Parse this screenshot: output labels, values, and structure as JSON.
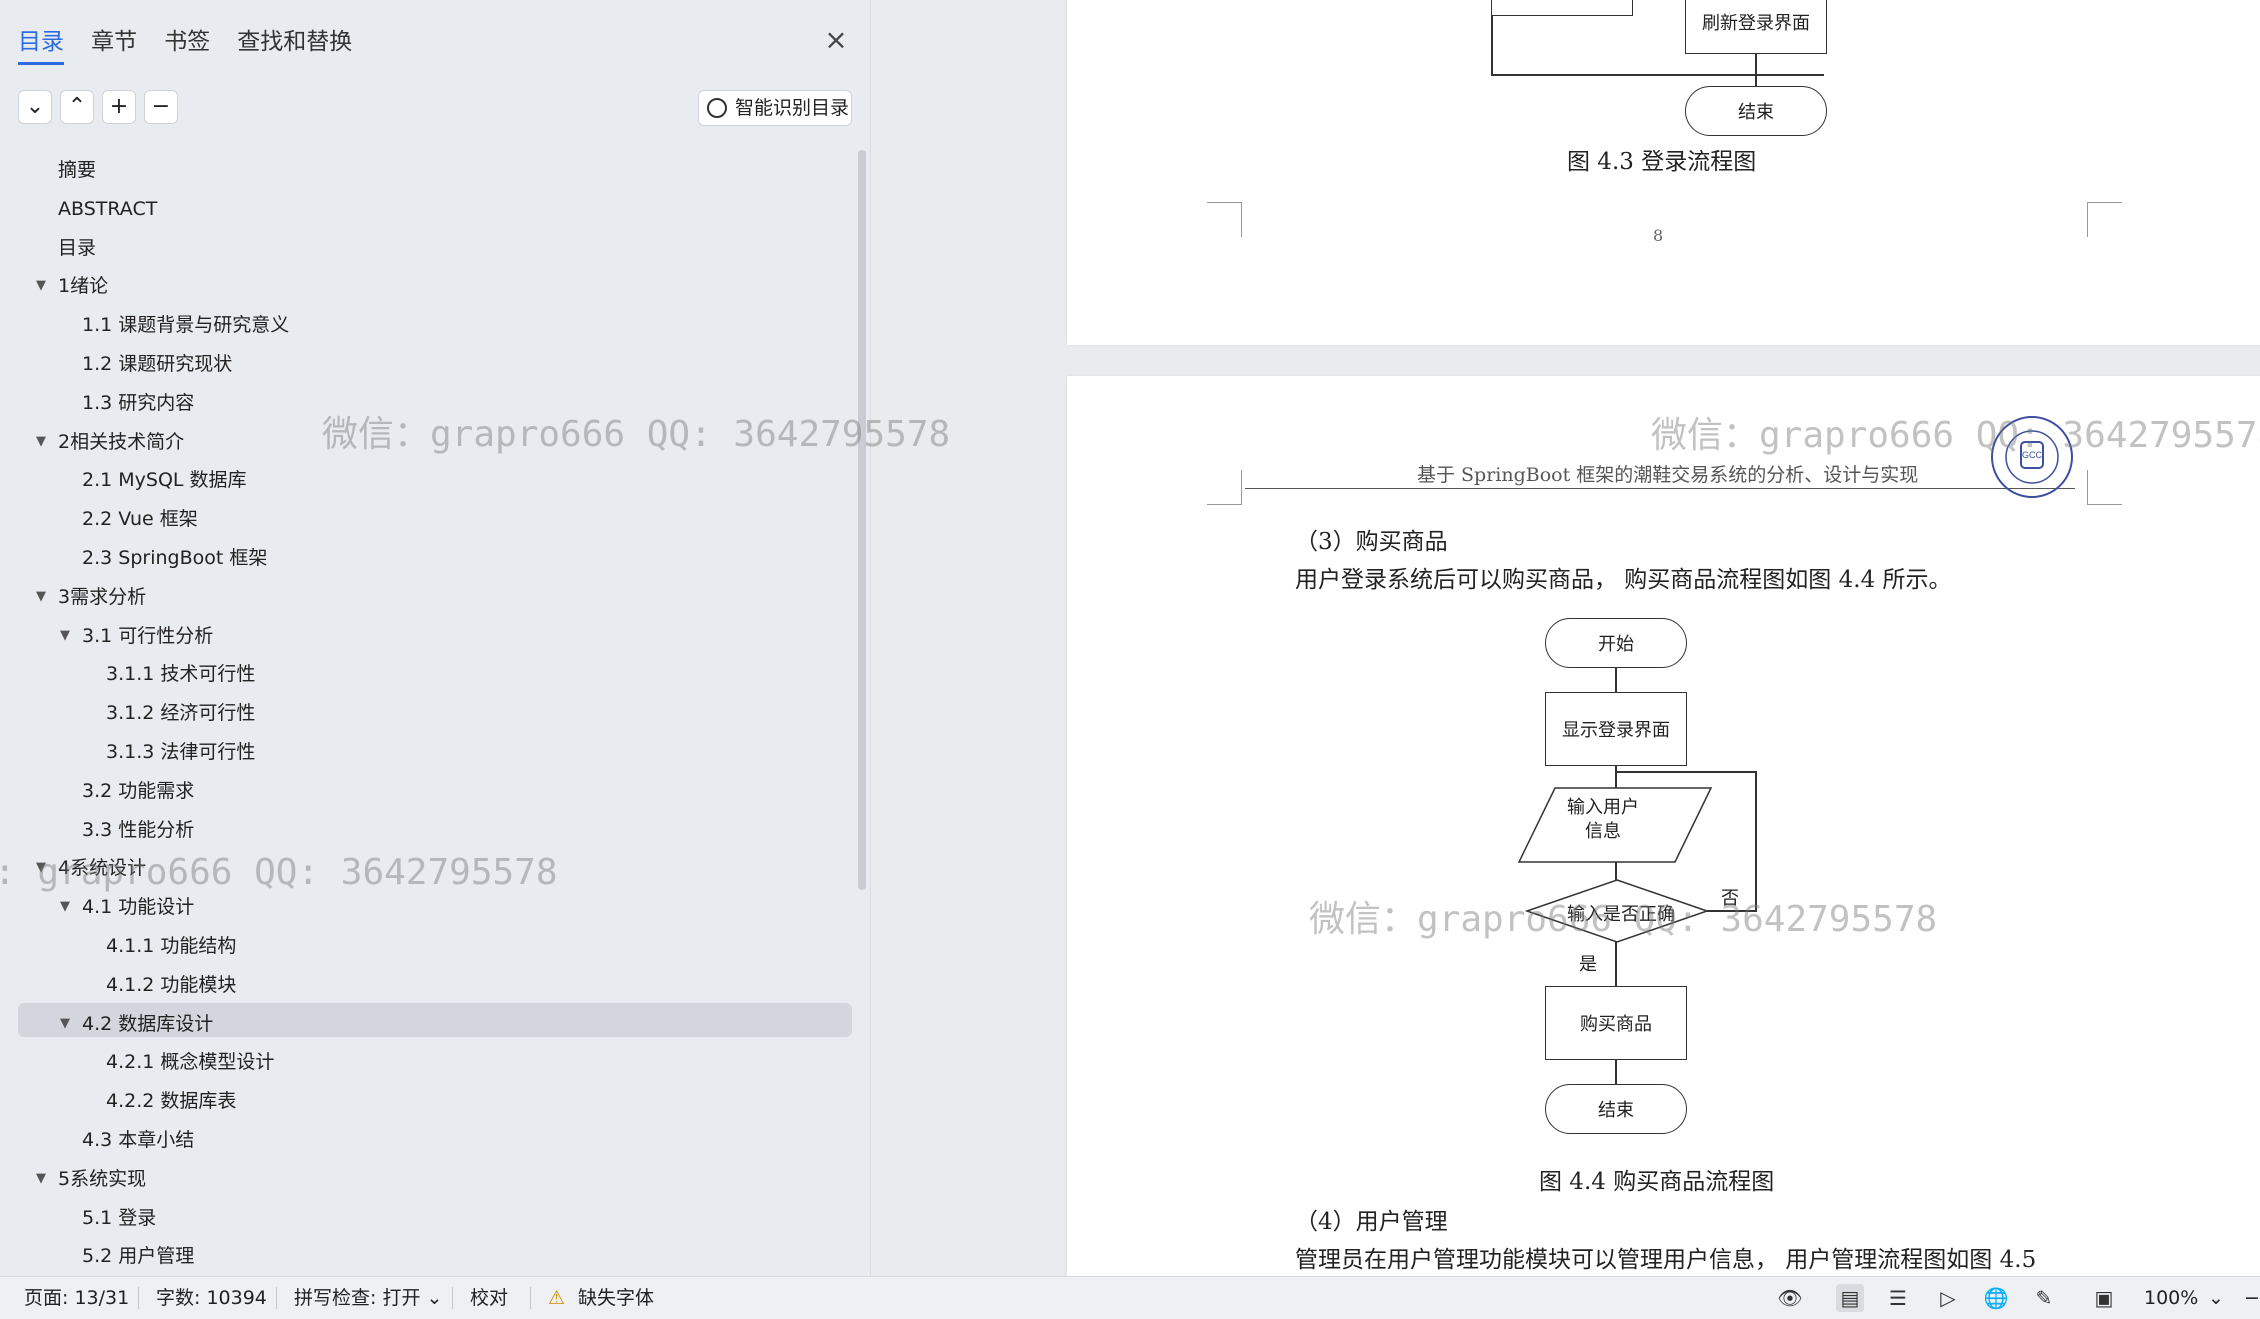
{
  "nav": {
    "tabs": [
      "目录",
      "章节",
      "书签",
      "查找和替换"
    ],
    "close_icon": "×",
    "smart_button": "智能识别目录",
    "toc": [
      {
        "label": "摘要",
        "level": 0
      },
      {
        "label": "ABSTRACT",
        "level": 0
      },
      {
        "label": "目录",
        "level": 0
      },
      {
        "label": "1绪论",
        "level": 0,
        "expanded": true
      },
      {
        "label": "1.1  课题背景与研究意义",
        "level": 1
      },
      {
        "label": "1.2  课题研究现状",
        "level": 1
      },
      {
        "label": "1.3  研究内容",
        "level": 1
      },
      {
        "label": "2相关技术简介",
        "level": 0,
        "expanded": true
      },
      {
        "label": "2.1  MySQL 数据库",
        "level": 1
      },
      {
        "label": "2.2  Vue 框架",
        "level": 1
      },
      {
        "label": "2.3  SpringBoot 框架",
        "level": 1
      },
      {
        "label": "3需求分析",
        "level": 0,
        "expanded": true
      },
      {
        "label": "3.1  可行性分析",
        "level": 1,
        "expanded": true
      },
      {
        "label": "3.1.1  技术可行性",
        "level": 2
      },
      {
        "label": "3.1.2  经济可行性",
        "level": 2
      },
      {
        "label": "3.1.3  法律可行性",
        "level": 2
      },
      {
        "label": "3.2  功能需求",
        "level": 1
      },
      {
        "label": "3.3  性能分析",
        "level": 1
      },
      {
        "label": "4系统设计",
        "level": 0,
        "expanded": true,
        "selected": true
      },
      {
        "label": "4.1  功能设计",
        "level": 1,
        "expanded": true
      },
      {
        "label": "4.1.1  功能结构",
        "level": 2
      },
      {
        "label": "4.1.2  功能模块",
        "level": 2
      },
      {
        "label": "4.2  数据库设计",
        "level": 1,
        "expanded": true
      },
      {
        "label": "4.2.1  概念模型设计",
        "level": 2
      },
      {
        "label": "4.2.2  数据库表",
        "level": 2
      },
      {
        "label": "4.3  本章小结",
        "level": 1
      },
      {
        "label": "5系统实现",
        "level": 0,
        "expanded": true
      },
      {
        "label": "5.1  登录",
        "level": 1
      },
      {
        "label": "5.2  用户管理",
        "level": 1
      }
    ]
  },
  "doc": {
    "page1": {
      "box_refresh": "刷新登录界面",
      "box_end": "结束",
      "caption": "图 4.3  登录流程图",
      "page_number": "8"
    },
    "page2": {
      "header": "基于 SpringBoot 框架的潮鞋交易系统的分析、设计与实现",
      "section3": "（3）购买商品",
      "para3": "用户登录系统后可以购买商品，  购买商品流程图如图 4.4 所示。",
      "fc_start": "开始",
      "fc_show": "显示登录界面",
      "fc_input": "输入用户\n信息",
      "fc_decision": "输入是否正确",
      "fc_no": "否",
      "fc_yes": "是",
      "fc_buy": "购买商品",
      "fc_end": "结束",
      "caption": "图 4.4  购买商品流程图",
      "section4": "（4）用户管理",
      "para4": "管理员在用户管理功能模块可以管理用户信息，  用户管理流程图如图 4.5"
    },
    "watermark": "微信：grapro666 QQ: 3642795578",
    "watermark_partial": ": grapro666 QQ: 3642795578"
  },
  "status": {
    "page": "页面: 13/31",
    "words": "字数: 10394",
    "spell": "拼写检查: 打开",
    "proof": "校对",
    "missing_font": "缺失字体",
    "zoom": "100%"
  },
  "colors": {
    "accent": "#2b6de0"
  }
}
